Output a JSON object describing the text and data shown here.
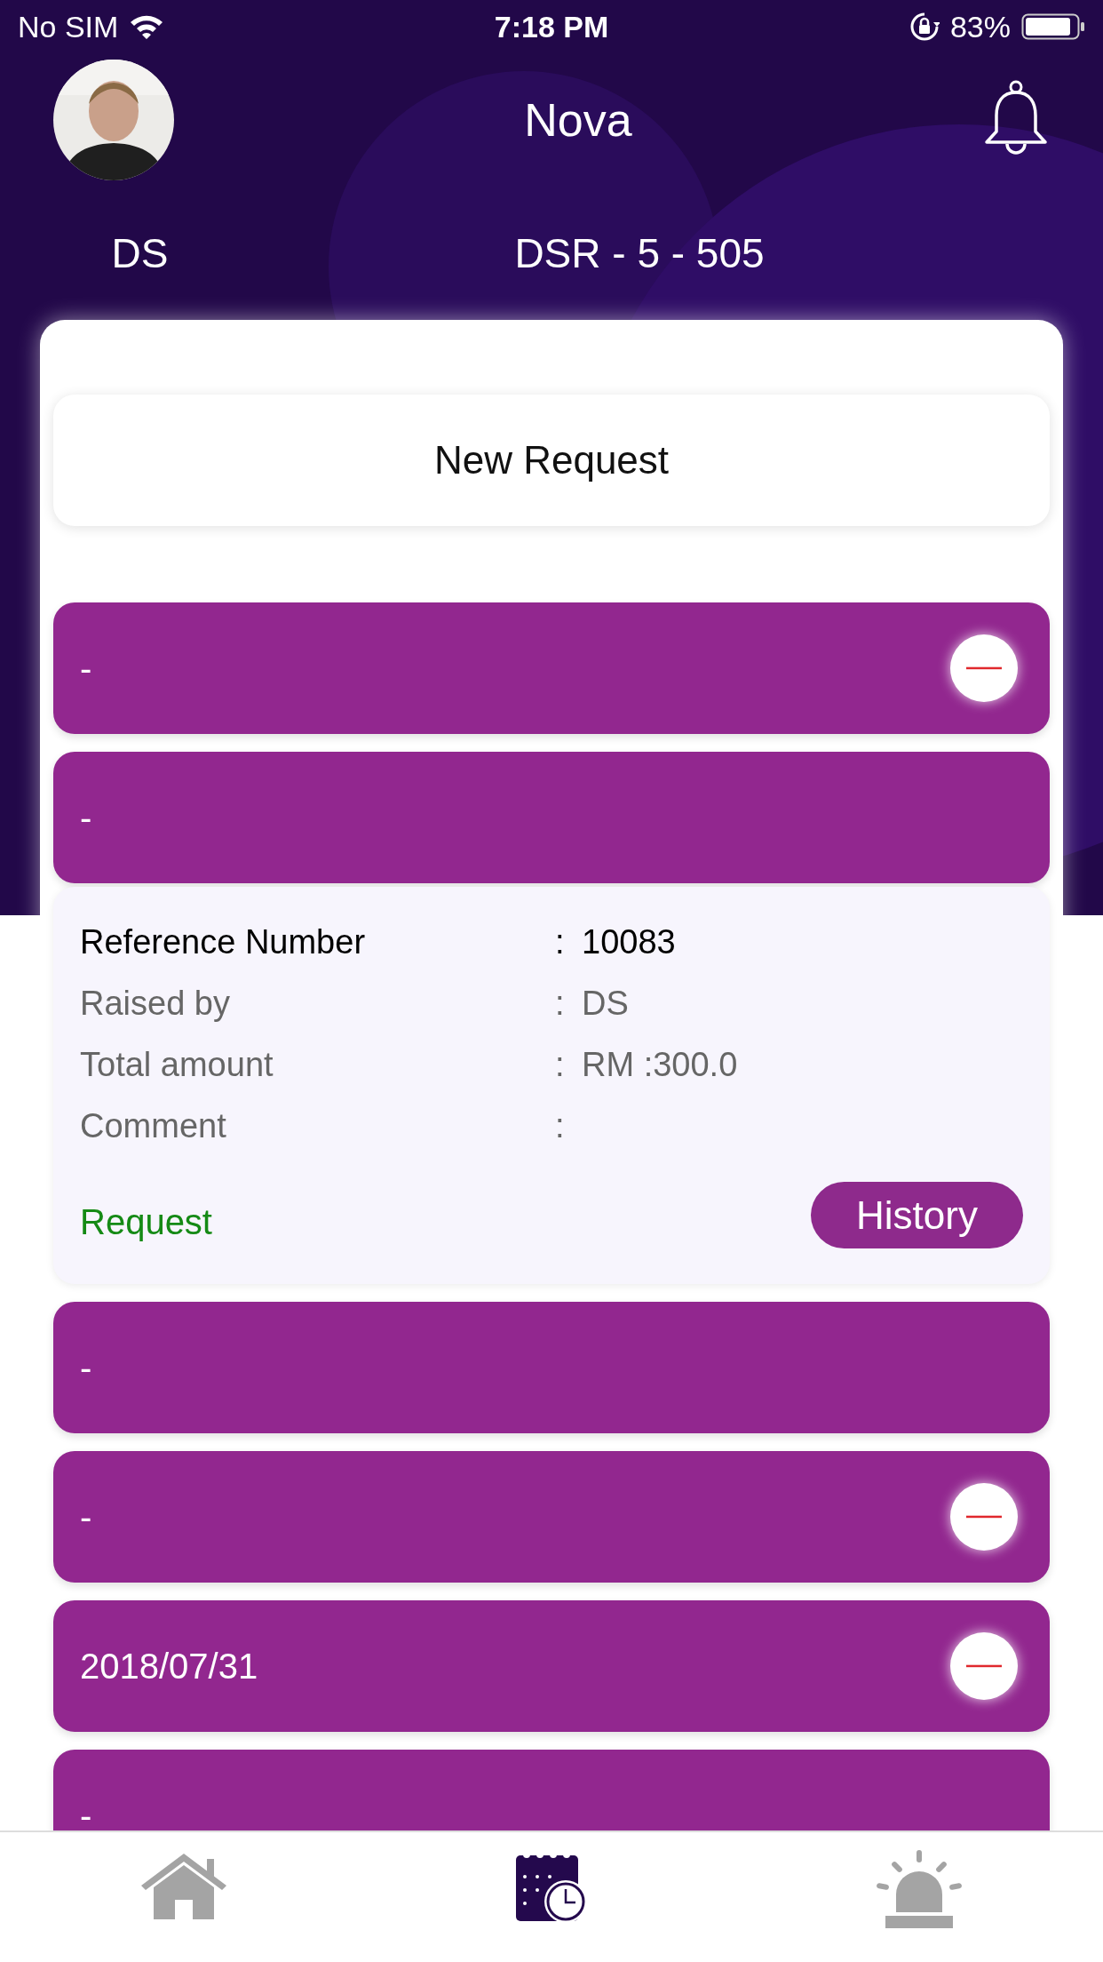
{
  "status_bar": {
    "carrier": "No SIM",
    "time": "7:18 PM",
    "battery": "83%"
  },
  "header": {
    "title": "Nova",
    "user": "DS",
    "code": "DSR - 5 - 505"
  },
  "new_request": {
    "label": "New Request"
  },
  "requests": [
    {
      "label": "-",
      "removable": true
    },
    {
      "label": "-",
      "removable": false,
      "details": {
        "fields": [
          {
            "label": "Reference Number",
            "separator": ":",
            "value": "10083",
            "primary": true
          },
          {
            "label": "Raised by",
            "separator": ":",
            "value": "DS",
            "primary": false
          },
          {
            "label": "Total amount",
            "separator": ":",
            "value": "RM :300.0",
            "primary": false
          },
          {
            "label": "Comment",
            "separator": ":",
            "primary": false
          }
        ],
        "status": "Request",
        "action": "History"
      }
    },
    {
      "label": "-",
      "removable": false
    },
    {
      "label": "-",
      "removable": true
    },
    {
      "label": "2018/07/31",
      "removable": true
    },
    {
      "label": "-",
      "removable": false
    }
  ],
  "tabs": [
    {
      "kind": "home",
      "selected": false
    },
    {
      "kind": "calendar",
      "selected": true
    },
    {
      "kind": "alarm",
      "selected": false
    }
  ]
}
